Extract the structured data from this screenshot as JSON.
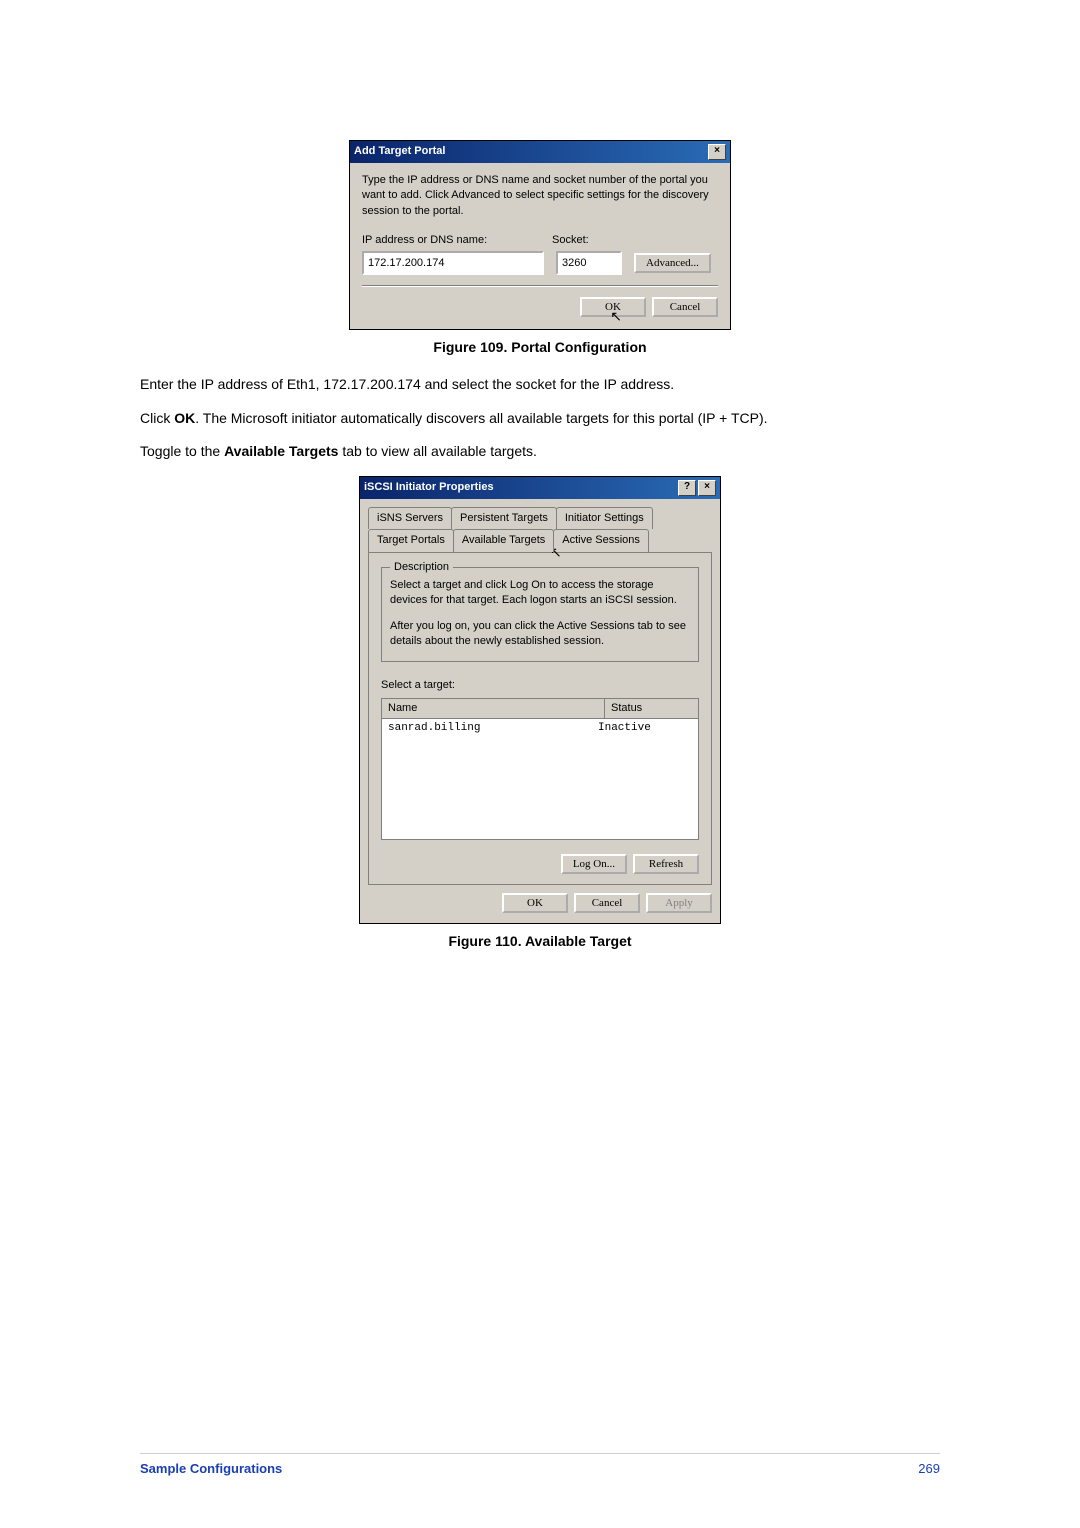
{
  "dialog1": {
    "title": "Add Target Portal",
    "close": "×",
    "instr": "Type the IP address or DNS name and socket number of the portal you want to add. Click Advanced to select specific settings for the discovery session to the portal.",
    "ip_label": "IP address or DNS name:",
    "socket_label": "Socket:",
    "ip_value": "172.17.200.174",
    "socket_value": "3260",
    "advanced": "Advanced...",
    "ok": "OK",
    "cancel": "Cancel"
  },
  "fig109": "Figure 109.    Portal Configuration",
  "p1": "Enter the IP address of Eth1, 172.17.200.174 and select the socket for the IP address.",
  "p2a": "Click ",
  "p2b": "OK",
  "p2c": ".   The Microsoft initiator automatically discovers all available targets for this portal (IP + TCP).",
  "p3a": "Toggle to the ",
  "p3b": "Available Targets",
  "p3c": " tab to view all available targets.",
  "dialog2": {
    "title": "iSCSI Initiator Properties",
    "help": "?",
    "close": "×",
    "tabs": {
      "isns": "iSNS Servers",
      "persistent": "Persistent Targets",
      "initiator": "Initiator Settings",
      "portals": "Target Portals",
      "available": "Available Targets",
      "sessions": "Active Sessions"
    },
    "group": "Description",
    "desc1": "Select a target and click Log On to access the storage devices for that target. Each logon starts an iSCSI session.",
    "desc2": "After you log on, you can click the Active Sessions tab to see details about the newly established session.",
    "select_label": "Select a target:",
    "col_name": "Name",
    "col_status": "Status",
    "row_name": "sanrad.billing",
    "row_status": "Inactive",
    "logon": "Log On...",
    "refresh": "Refresh",
    "ok": "OK",
    "cancel": "Cancel",
    "apply": "Apply"
  },
  "fig110": "Figure 110.    Available Target",
  "footer": {
    "left": "Sample Configurations",
    "right": "269"
  }
}
